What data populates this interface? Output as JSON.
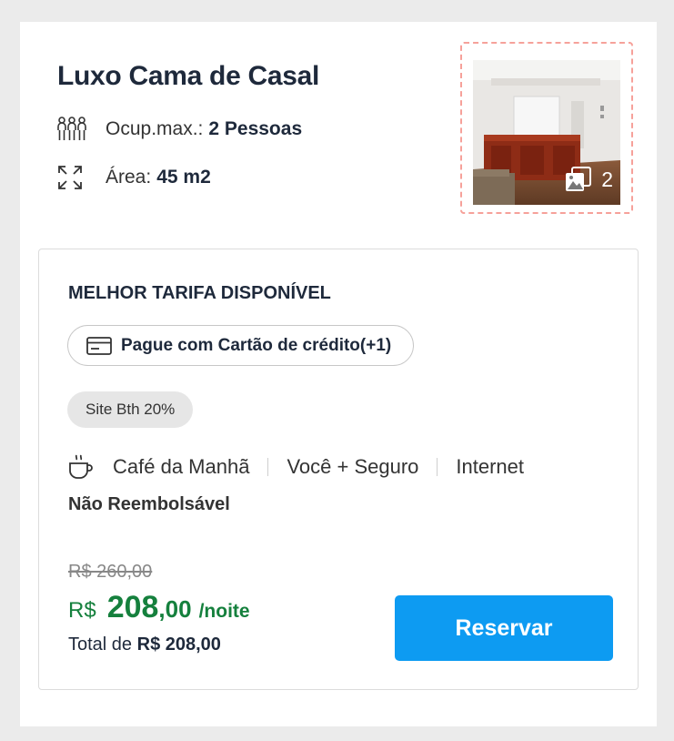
{
  "room": {
    "title": "Luxo Cama de Casal",
    "occupancy_label": "Ocup.max.:",
    "occupancy_value": "2 Pessoas",
    "area_label": "Área:",
    "area_value": "45 m2",
    "photo_count": "2"
  },
  "rate": {
    "title": "MELHOR TARIFA DISPONÍVEL",
    "payment_label": "Pague com Cartão de crédito(+1)",
    "site_badge": "Site Bth 20%",
    "amenities": [
      "Café da Manhã",
      "Você + Seguro",
      "Internet"
    ],
    "refund_policy": "Não Reembolsável",
    "old_price": "R$ 260,00",
    "currency": "R$",
    "price_integer": "208",
    "price_decimal": ",00",
    "per_night": "/noite",
    "total_label": "Total de",
    "total_value": "R$ 208,00",
    "reserve_label": "Reservar"
  },
  "colors": {
    "accent": "#0d9bf2",
    "price_green": "#15803d",
    "photo_border": "#f6a19a"
  },
  "icons": {
    "occupancy": "people-icon",
    "area": "expand-icon",
    "photos": "gallery-icon",
    "payment": "credit-card-icon",
    "breakfast": "coffee-cup-icon"
  }
}
